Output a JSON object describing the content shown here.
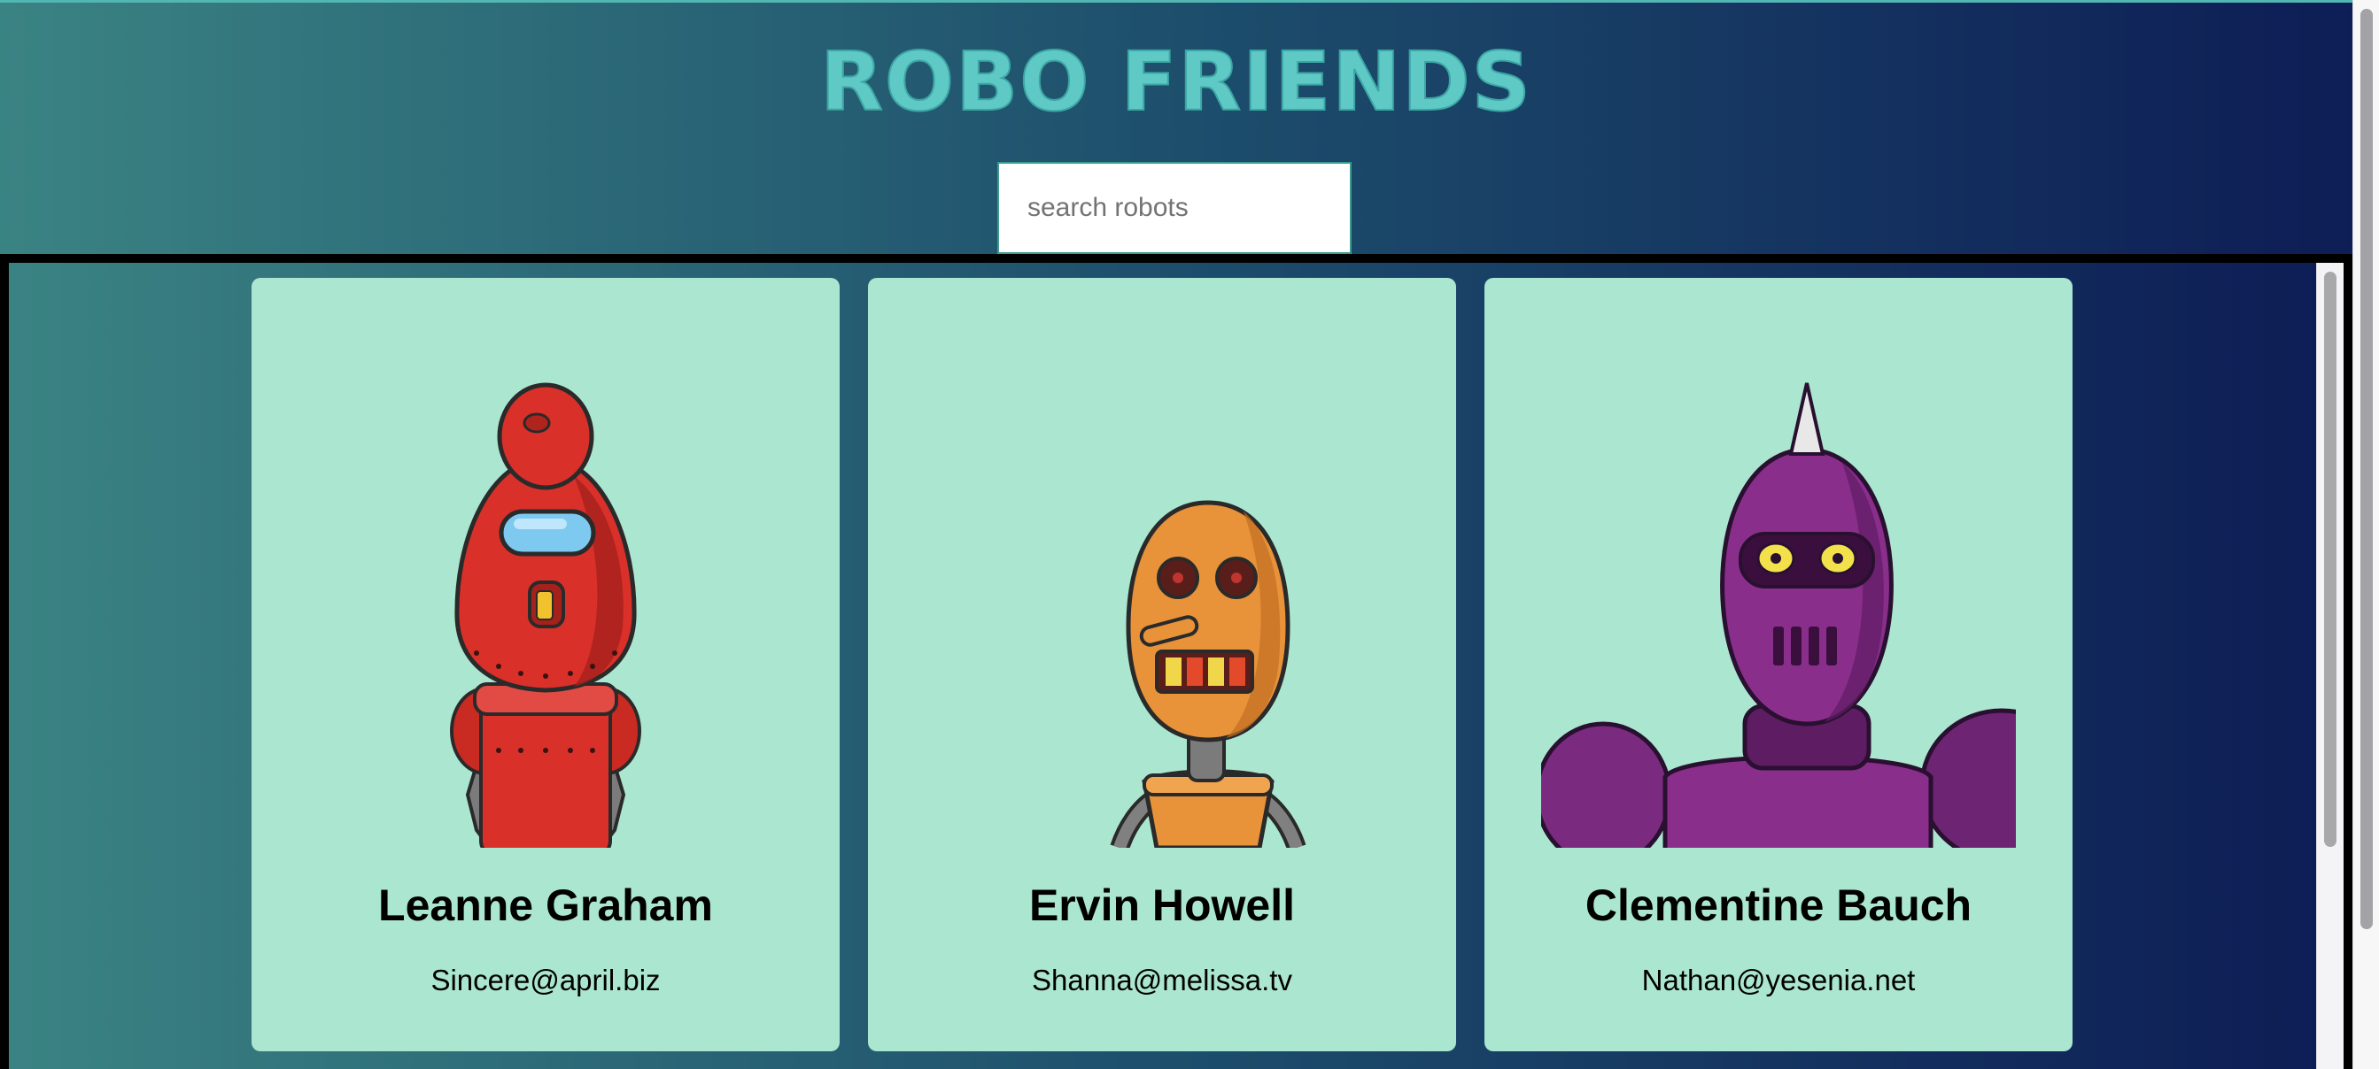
{
  "header": {
    "title": "ROBO FRIENDS",
    "search": {
      "placeholder": "search robots",
      "value": ""
    }
  },
  "robots": [
    {
      "name": "Leanne Graham",
      "email": "Sincere@april.biz",
      "image_icon": "red-robot-avatar-icon",
      "color": "#d9302a"
    },
    {
      "name": "Ervin Howell",
      "email": "Shanna@melissa.tv",
      "image_icon": "orange-robot-avatar-icon",
      "color": "#e8923a"
    },
    {
      "name": "Clementine Bauch",
      "email": "Nathan@yesenia.net",
      "image_icon": "purple-robot-avatar-icon",
      "color": "#8a2e8c"
    }
  ],
  "colors": {
    "card_background": "#abe6d0",
    "title_color": "#5fc9c6",
    "gradient_start": "#3a8383",
    "gradient_end": "#0d1c55"
  }
}
